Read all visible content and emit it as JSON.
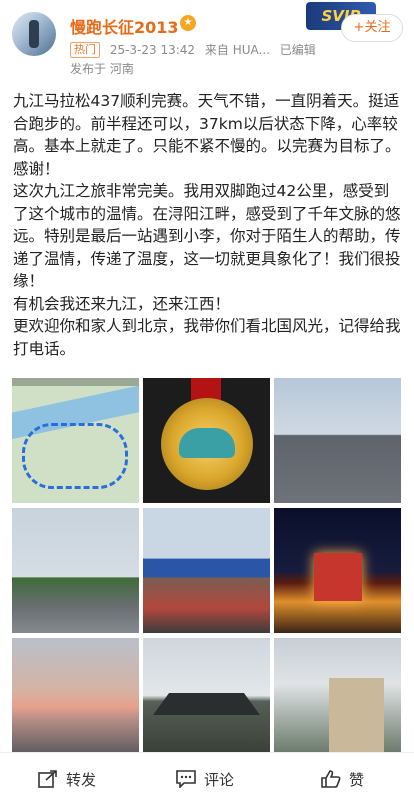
{
  "header": {
    "username": "慢跑长征2013",
    "tag": "热门",
    "timestamp": "25-3-23 13:42",
    "source": "来自 HUA...",
    "edited": "已编辑",
    "location": "发布于 河南",
    "follow_label": "+关注",
    "banner_text": "SVIP"
  },
  "post": {
    "paragraphs": [
      "九江马拉松437顺利完赛。天气不错，一直阴着天。挺适合跑步的。前半程还可以，37km以后状态下降，心率较高。基本上就走了。只能不紧不慢的。以完赛为目标了。",
      "感谢！",
      "这次九江之旅非常完美。我用双脚跑过42公里，感受到了这个城市的温情。在浔阳江畔，感受到了千年文脉的悠远。特别是最后一站遇到小李，你对于陌生人的帮助，传递了温情，传递了温度，这一切就更具象化了！我们很投缘！",
      "有机会我还来九江，还来江西！",
      "更欢迎你和家人到北京，我带你们看北国风光，记得给我打电话。"
    ]
  },
  "photos": [
    {
      "name": "photo-route-map"
    },
    {
      "name": "photo-medal"
    },
    {
      "name": "photo-runners-street"
    },
    {
      "name": "photo-road-trees"
    },
    {
      "name": "photo-start-crowd"
    },
    {
      "name": "photo-night-tower"
    },
    {
      "name": "photo-sunset-lake"
    },
    {
      "name": "photo-pavilion"
    },
    {
      "name": "photo-old-building"
    }
  ],
  "actions": {
    "repost_label": "转发",
    "comment_label": "评论",
    "like_label": "赞"
  },
  "colors": {
    "username": "#e86b1a",
    "meta": "#8a8a8a"
  }
}
